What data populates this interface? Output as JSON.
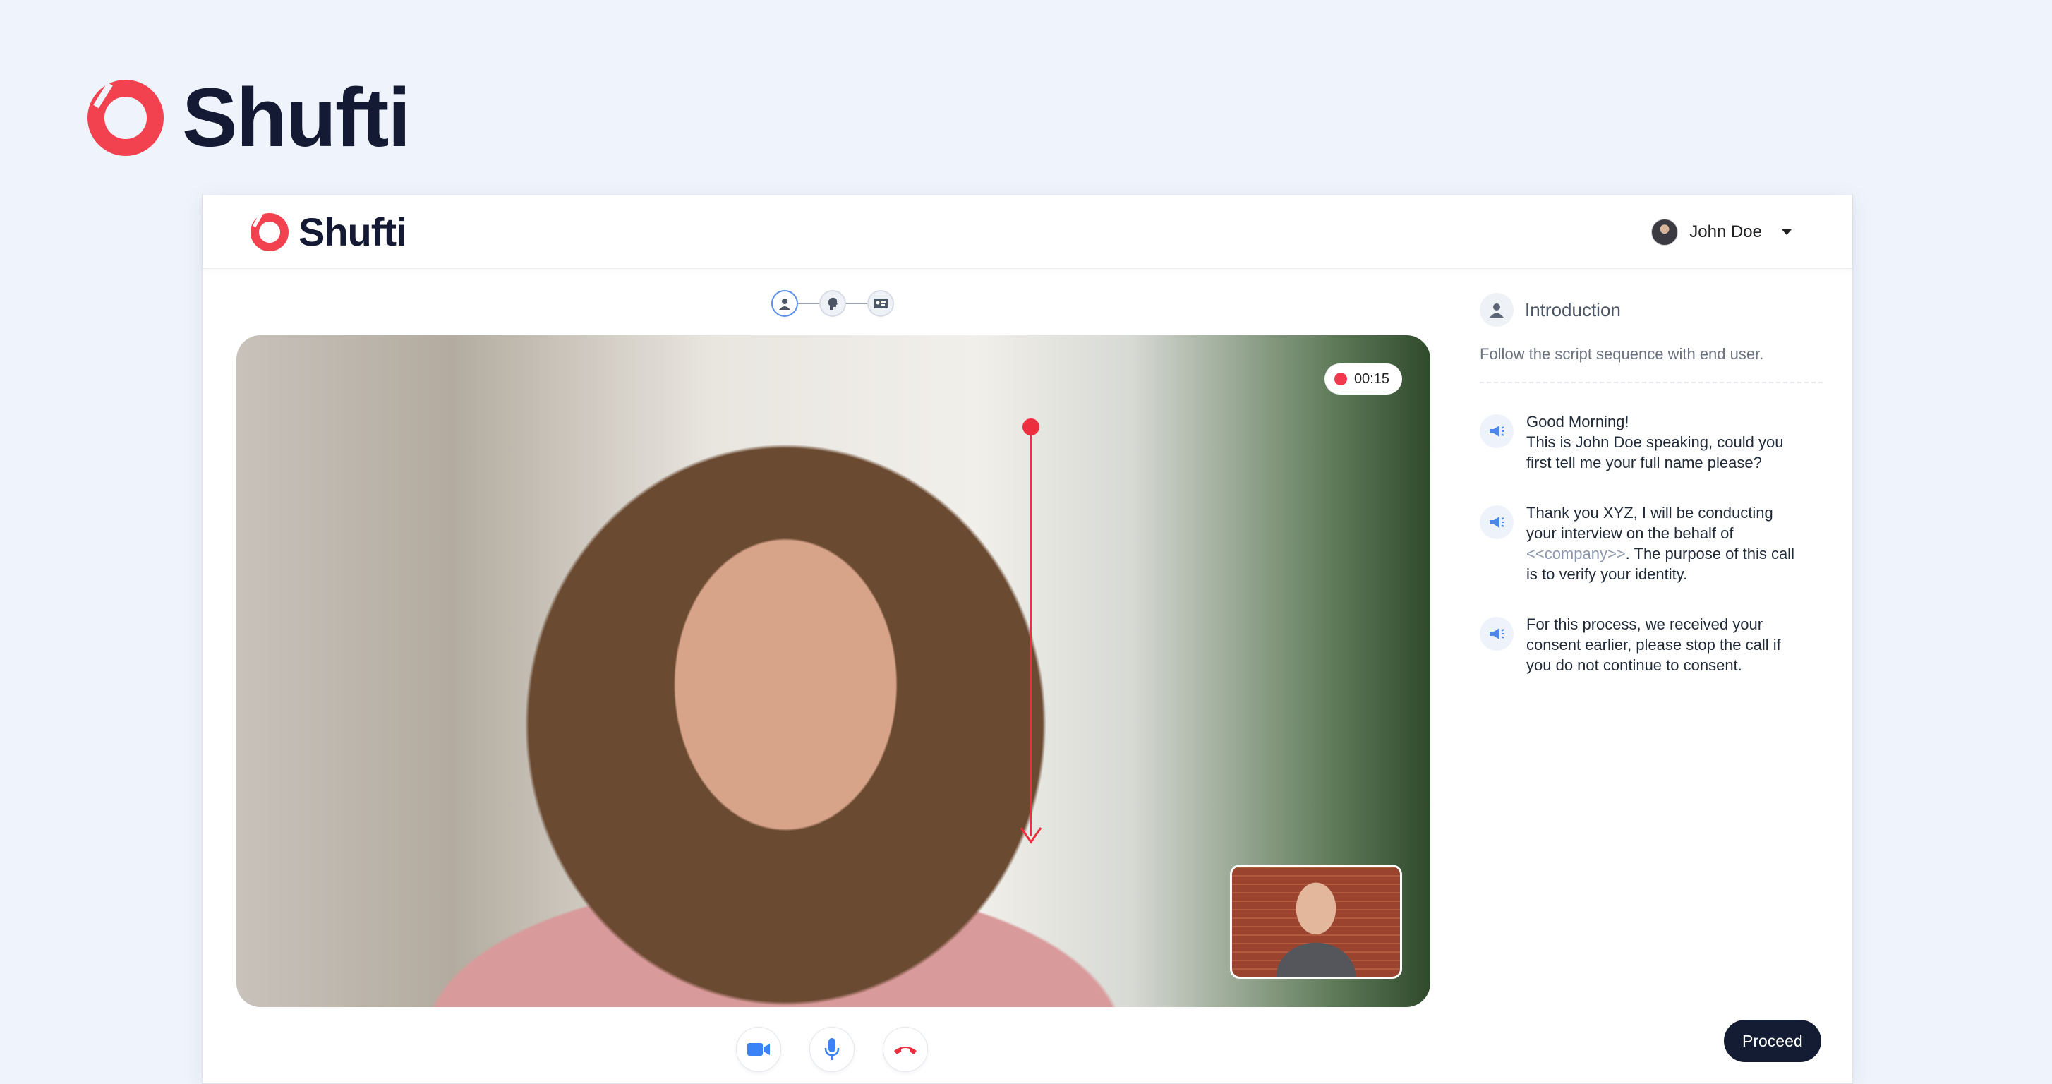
{
  "brand": {
    "name": "Shufti",
    "accent": "#f2414f"
  },
  "app": {
    "brand_name": "Shufti",
    "user": {
      "name": "John Doe"
    }
  },
  "stepper": {
    "icons": [
      "person-icon",
      "head-icon",
      "id-card-icon"
    ],
    "active_index": 0
  },
  "video": {
    "recording_time": "00:15",
    "recording_color": "#f0394c"
  },
  "controls": {
    "icons": [
      "video-camera-icon",
      "microphone-icon",
      "hang-up-icon"
    ],
    "colors": {
      "camera": "#3b82f6",
      "mic": "#3b82f6",
      "hangup": "#ec2e3f"
    }
  },
  "panel": {
    "title": "Introduction",
    "subtitle": "Follow the script sequence with end user.",
    "scripts": [
      {
        "lines": [
          "Good Morning!",
          "This is John Doe speaking, could you",
          "first tell me your full name please?"
        ]
      },
      {
        "line1": "Thank you XYZ, I will be conducting",
        "line2": "your interview on the behalf of",
        "placeholder": "<<company>>",
        "line3_rest": ". The purpose of this call",
        "line4": "is to verify your identity."
      },
      {
        "lines": [
          "For this process, we received your",
          "consent earlier, please stop the call if",
          "you do not continue to consent."
        ]
      }
    ]
  },
  "proceed_label": "Proceed"
}
